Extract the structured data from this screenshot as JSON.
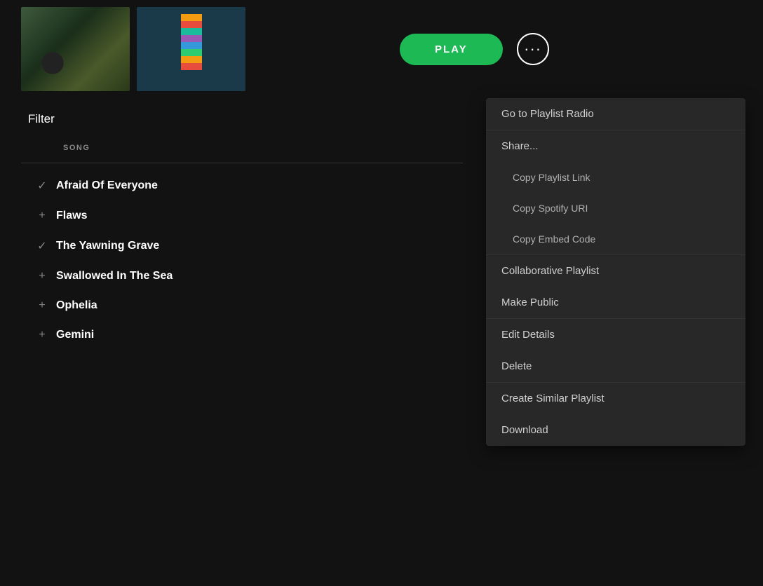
{
  "topArea": {
    "playButton": "PLAY",
    "moreButton": "···"
  },
  "songList": {
    "filterLabel": "Filter",
    "columnHeader": "SONG",
    "songs": [
      {
        "icon": "✓",
        "name": "Afraid Of Everyone"
      },
      {
        "icon": "+",
        "name": "Flaws"
      },
      {
        "icon": "✓",
        "name": "The Yawning Grave"
      },
      {
        "icon": "+",
        "name": "Swallowed In The Sea"
      },
      {
        "icon": "+",
        "name": "Ophelia"
      },
      {
        "icon": "+",
        "name": "Gemini"
      }
    ]
  },
  "contextMenu": {
    "items": [
      {
        "id": "go-to-playlist-radio",
        "label": "Go to Playlist Radio",
        "section": "main"
      },
      {
        "id": "share",
        "label": "Share...",
        "section": "share-parent"
      },
      {
        "id": "copy-playlist-link",
        "label": "Copy Playlist Link",
        "section": "share-child"
      },
      {
        "id": "copy-spotify-uri",
        "label": "Copy Spotify URI",
        "section": "share-child"
      },
      {
        "id": "copy-embed-code",
        "label": "Copy Embed Code",
        "section": "share-child"
      },
      {
        "id": "collaborative-playlist",
        "label": "Collaborative Playlist",
        "section": "collab"
      },
      {
        "id": "make-public",
        "label": "Make Public",
        "section": "collab"
      },
      {
        "id": "edit-details",
        "label": "Edit Details",
        "section": "edit"
      },
      {
        "id": "delete",
        "label": "Delete",
        "section": "edit"
      },
      {
        "id": "create-similar-playlist",
        "label": "Create Similar Playlist",
        "section": "create"
      },
      {
        "id": "download",
        "label": "Download",
        "section": "create"
      }
    ]
  }
}
